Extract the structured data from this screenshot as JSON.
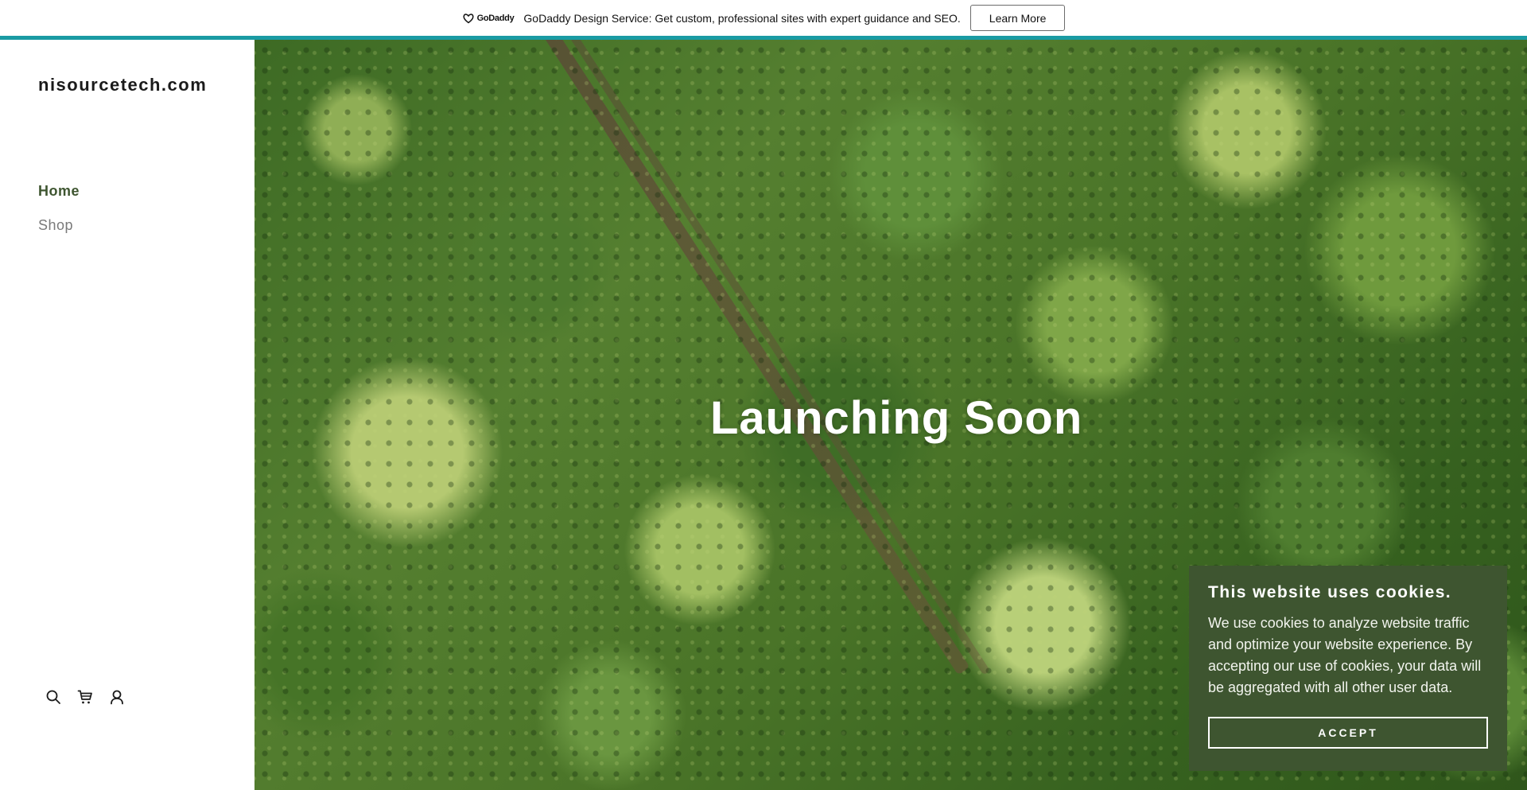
{
  "promo": {
    "logo_text": "GoDaddy",
    "logo_icon": "godaddy-logo-icon",
    "message": "GoDaddy Design Service: Get custom, professional sites with expert guidance and SEO.",
    "button_label": "Learn More"
  },
  "colors": {
    "accent_teal": "#1a9ba3",
    "brand_green": "#3e5530",
    "nav_inactive": "#7a7a7a"
  },
  "sidebar": {
    "site_title": "nisourcetech.com",
    "nav": [
      {
        "label": "Home",
        "active": true
      },
      {
        "label": "Shop",
        "active": false
      }
    ],
    "icons": [
      "search-icon",
      "cart-icon",
      "account-icon"
    ]
  },
  "hero": {
    "title": "Launching Soon"
  },
  "cookie": {
    "title": "This website uses cookies.",
    "body": "We use cookies to analyze website traffic and optimize your website experience. By accepting our use of cookies, your data will be aggregated with all other user data.",
    "accept_label": "ACCEPT"
  }
}
